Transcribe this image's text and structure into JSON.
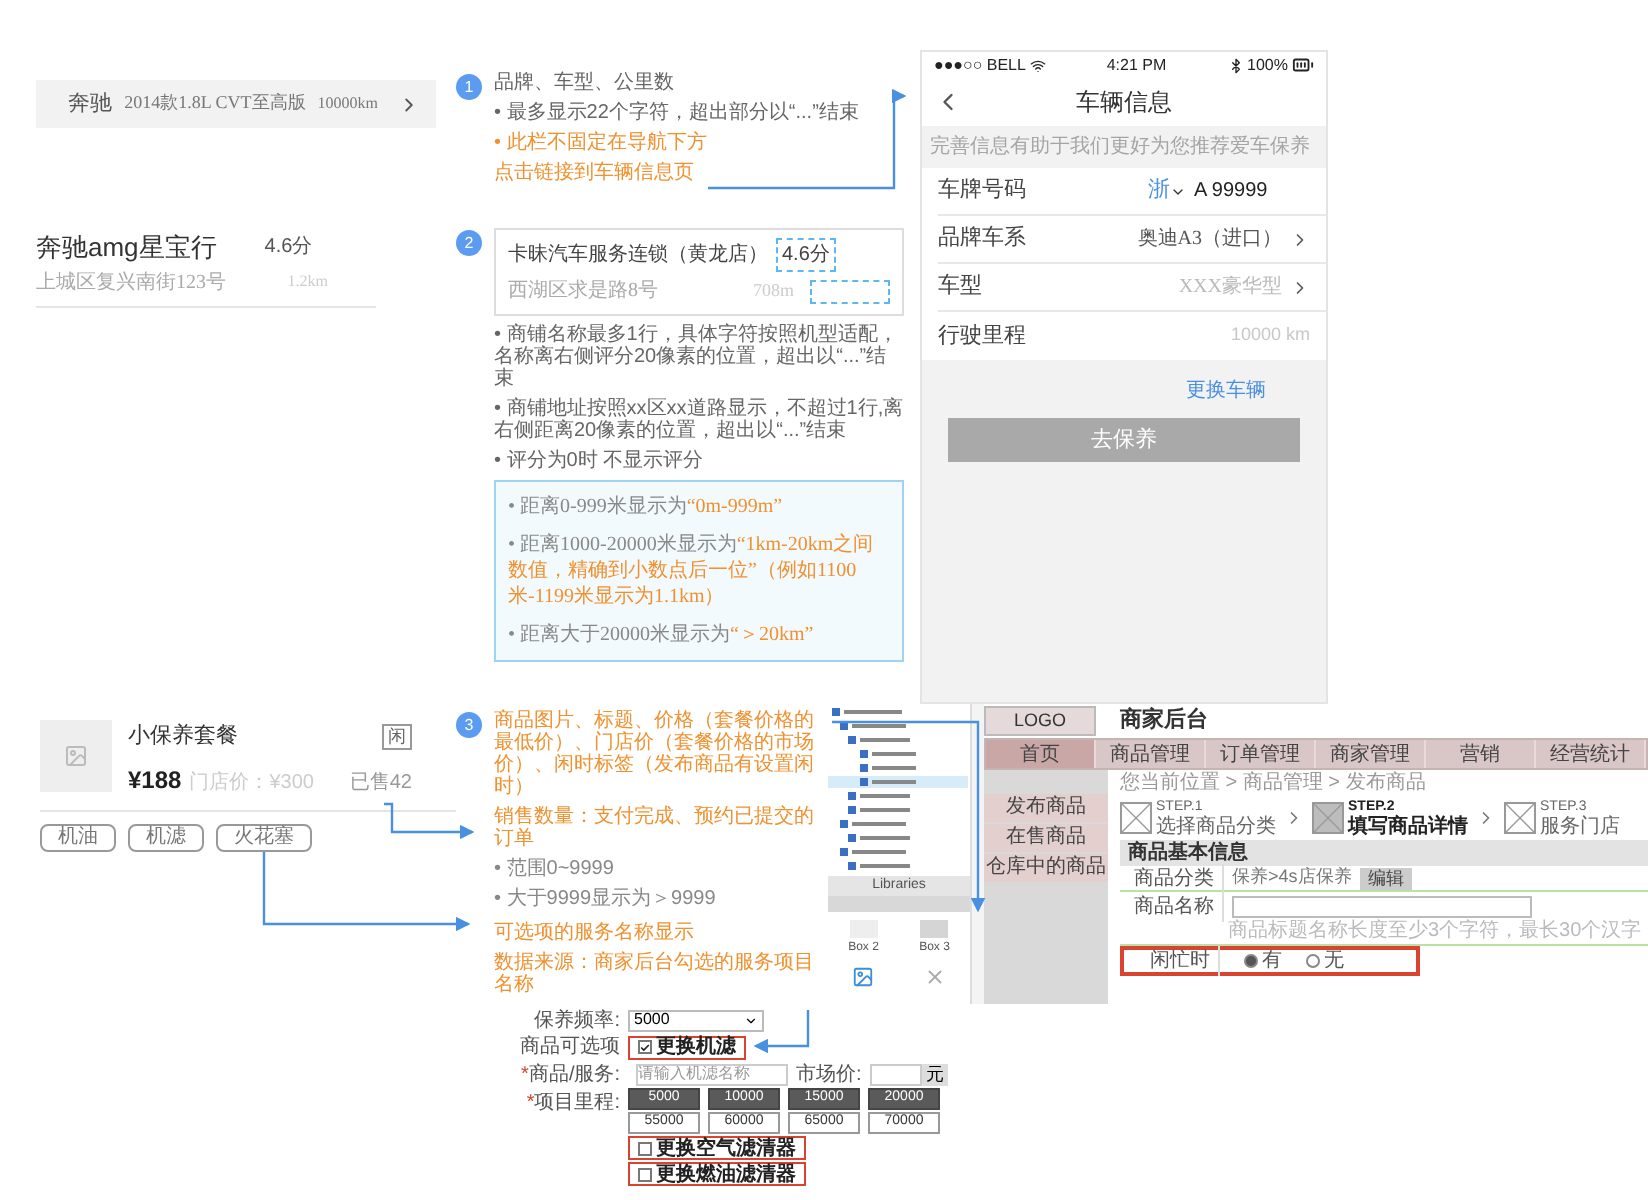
{
  "vehicle_bar": {
    "brand": "奔驰",
    "model": "2014款1.8L CVT至高版",
    "mileage": "10000km"
  },
  "shop_item": {
    "name": "奔驰amg星宝行",
    "rating": "4.6分",
    "address": "上城区复兴南街123号",
    "distance": "1.2km"
  },
  "product_card": {
    "title": "小保养套餐",
    "price": "¥188",
    "store_price": "门店价：¥300",
    "badge": "闲",
    "sold": "已售42",
    "tags": [
      "机油",
      "机滤",
      "火花塞"
    ]
  },
  "annotations": [
    {
      "number": "1",
      "lines": [
        {
          "text": "品牌、车型、公里数",
          "color": "#666666"
        },
        {
          "text": "• 最多显示22个字符，超出部分以“...”结束",
          "color": "#666666"
        },
        {
          "text": "• 此栏不固定在导航下方",
          "color": "#f0912f"
        },
        {
          "text": "点击链接到车辆信息页",
          "color": "#f0912f"
        }
      ]
    },
    {
      "number": "2",
      "preview": {
        "name": "卡昧汽车服务连锁（黄龙店）",
        "rating": "4.6分",
        "address": "西湖区求是路8号",
        "distance": "708m"
      },
      "lines": [
        {
          "text": "• 商铺名称最多1行，具体字符按照机型适配，名称离右侧评分20像素的位置，超出以“...”结束",
          "color": "#666666"
        },
        {
          "text": "• 商铺地址按照xx区xx道路显示，不超过1行,离右侧距离20像素的位置，超出以“...”结束",
          "color": "#666666"
        },
        {
          "text": "• 评分为0时 不显示评分",
          "color": "#666666"
        }
      ],
      "rules": [
        [
          {
            "text": "• 距离0-999米显示为",
            "color": "#888888"
          },
          {
            "text": "“0m-999m”",
            "color": "#f0912f"
          }
        ],
        [
          {
            "text": "• 距离1000-20000米显示为",
            "color": "#888888"
          },
          {
            "text": "“1km-20km之间数值，精确到小数点后一位”（例如1100米-1199米显示为1.1km）",
            "color": "#f0912f"
          }
        ],
        [
          {
            "text": "• 距离大于20000米显示为",
            "color": "#888888"
          },
          {
            "text": "“＞20km”",
            "color": "#f0912f"
          }
        ]
      ]
    },
    {
      "number": "3",
      "lines": [
        {
          "text": "商品图片、标题、价格（套餐价格的最低价）、门店价（套餐价格的市场价）、闲时标签（发布商品有设置闲时）",
          "color": "#f0912f"
        },
        {
          "text": "销售数量：支付完成、预约已提交的订单",
          "color": "#f0912f"
        },
        {
          "text": "• 范围0~9999",
          "color": "#888888"
        },
        {
          "text": "• 大于9999显示为＞9999",
          "color": "#888888"
        }
      ]
    },
    {
      "lines": [
        {
          "text": "可选项的服务名称显示",
          "color": "#f0912f"
        },
        {
          "text": "数据来源：商家后台勾选的服务项目名称",
          "color": "#f0912f"
        }
      ]
    }
  ],
  "phone": {
    "carrier": "●●●○○ BELL",
    "time": "4:21 PM",
    "battery": "100%",
    "title": "车辆信息",
    "hint": "完善信息有助于我们更好为您推荐爱车保养",
    "rows": [
      {
        "kind": "plate",
        "label": "车牌号码",
        "province": "浙",
        "value": "A 99999"
      },
      {
        "kind": "select",
        "label": "品牌车系",
        "value": "奥迪A3（进口）"
      },
      {
        "kind": "select",
        "label": "车型",
        "placeholder": "XXX豪华型"
      },
      {
        "kind": "input",
        "label": "行驶里程",
        "placeholder": "10000 km"
      }
    ],
    "link": "更换车辆",
    "button": "去保养"
  },
  "backend": {
    "libraries": "Libraries",
    "boxes": [
      "Box 2",
      "Box 3"
    ],
    "logo": "LOGO",
    "title": "商家后台",
    "nav": [
      {
        "label": "首页",
        "selected": true
      },
      {
        "label": "商品管理",
        "selected": false
      },
      {
        "label": "订单管理",
        "selected": false
      },
      {
        "label": "商家管理",
        "selected": false
      },
      {
        "label": "营销",
        "selected": false
      },
      {
        "label": "经营统计",
        "selected": false
      }
    ],
    "sidebar": [
      "发布商品",
      "在售商品",
      "仓库中的商品"
    ],
    "breadcrumb": "您当前位置 > 商品管理 > 发布商品",
    "steps": [
      {
        "label": "STEP.1",
        "text": "选择商品分类",
        "selected": false
      },
      {
        "label": "STEP.2",
        "text": "填写商品详情",
        "selected": true
      },
      {
        "label": "STEP.3",
        "text": "服务门店",
        "selected": false
      }
    ],
    "section": "商品基本信息",
    "category_label": "商品分类",
    "category": "保养>4s店保养",
    "edit": "编辑",
    "name_label": "商品名称",
    "name_hint": "商品标题名称长度至少3个字符，最长30个汉字",
    "idle_label": "闲忙时",
    "idle_options": [
      {
        "label": "有",
        "selected": true
      },
      {
        "label": "无",
        "selected": false
      }
    ]
  },
  "service_form": {
    "frequency_label": "保养频率:",
    "frequency": "5000",
    "options_label": "商品可选项",
    "options": [
      {
        "label": "更换机滤",
        "checked": true
      },
      {
        "label": "更换空气滤清器",
        "checked": false
      },
      {
        "label": "更换燃油滤清器",
        "checked": false
      }
    ],
    "name_required": "*",
    "name_label": "商品/服务:",
    "name_placeholder": "请输入机滤名称",
    "price_label": "市场价:",
    "price_unit": "元",
    "mileage_required": "*",
    "mileage_label": "项目里程:",
    "mileages": [
      {
        "value": "5000",
        "selected": true
      },
      {
        "value": "10000",
        "selected": true
      },
      {
        "value": "15000",
        "selected": true
      },
      {
        "value": "20000",
        "selected": true
      },
      {
        "value": "55000",
        "selected": false
      },
      {
        "value": "60000",
        "selected": false
      },
      {
        "value": "65000",
        "selected": false
      },
      {
        "value": "70000",
        "selected": false
      }
    ]
  }
}
